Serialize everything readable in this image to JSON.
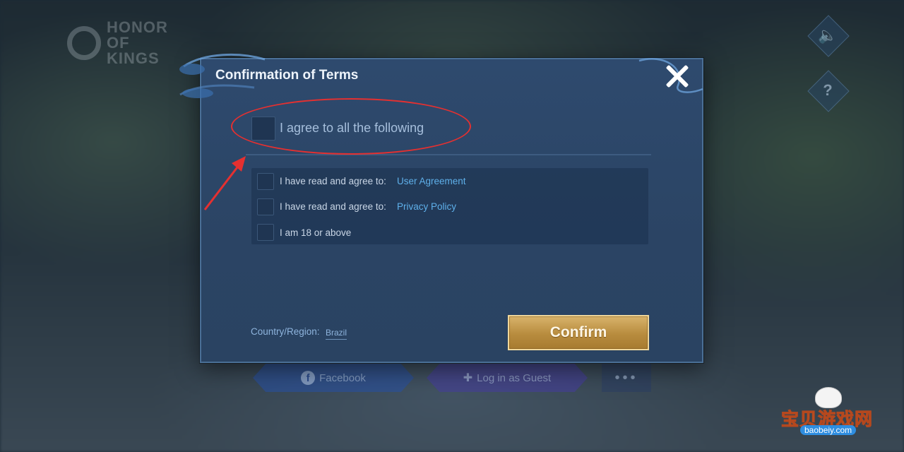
{
  "game": {
    "logo_text": "HONOR OF KINGS"
  },
  "dialog": {
    "title": "Confirmation of Terms",
    "agree_all_label": "I agree to all the following",
    "items": [
      {
        "text": "I have read and agree to:",
        "link": "User Agreement"
      },
      {
        "text": "I have read and agree to:",
        "link": "Privacy Policy"
      },
      {
        "text": "I am 18 or above",
        "link": ""
      }
    ],
    "country_label": "Country/Region:",
    "country_value": "Brazil",
    "confirm_label": "Confirm"
  },
  "login": {
    "facebook": "Facebook",
    "guest": "Log in as Guest",
    "more": "•••"
  },
  "side": {
    "sound_icon": "speaker-icon",
    "help_icon": "question-icon"
  },
  "watermark": {
    "text": "宝贝游戏网",
    "url": "baobeiy.com"
  },
  "colors": {
    "accent_gold": "#c9a14f",
    "link_blue": "#5fb0ea",
    "annotation_red": "#e53030"
  }
}
